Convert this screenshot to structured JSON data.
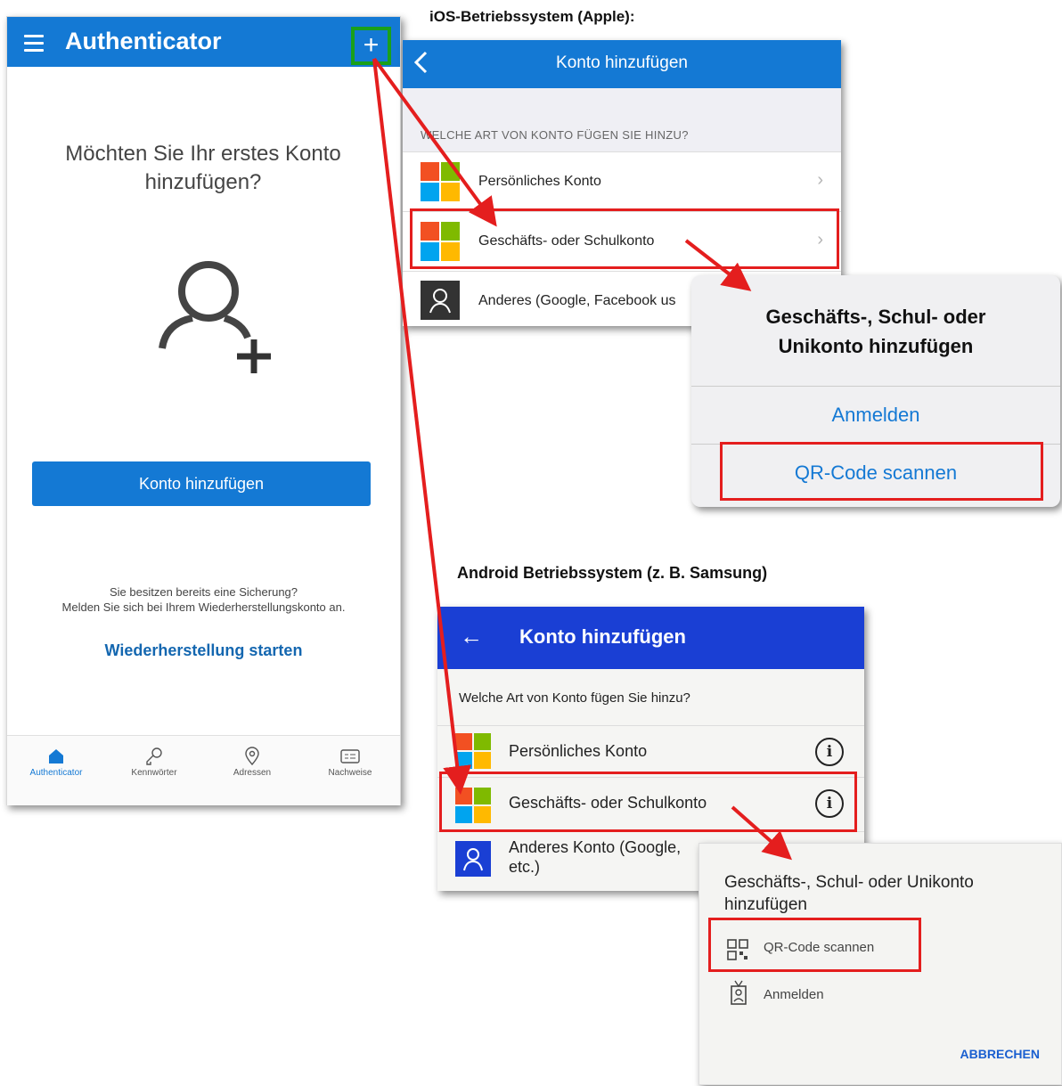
{
  "phone": {
    "title": "Authenticator",
    "question": "Möchten Sie Ihr erstes Konto hinzufügen?",
    "add_button": "Konto hinzufügen",
    "backup_line1": "Sie besitzen bereits eine Sicherung?",
    "backup_line2": "Melden Sie sich bei Ihrem Wiederherstellungskonto an.",
    "restore_link": "Wiederherstellung starten",
    "tabs": [
      {
        "label": "Authenticator",
        "icon": "home-icon"
      },
      {
        "label": "Kennwörter",
        "icon": "key-icon"
      },
      {
        "label": "Adressen",
        "icon": "location-pin-icon"
      },
      {
        "label": "Nachweise",
        "icon": "id-card-icon"
      }
    ]
  },
  "ios": {
    "heading": "iOS-Betriebssystem (Apple):",
    "nav_title": "Konto hinzufügen",
    "section_label": "WELCHE ART VON KONTO FÜGEN SIE HINZU?",
    "rows": [
      {
        "label": "Persönliches Konto"
      },
      {
        "label": "Geschäfts- oder Schulkonto"
      },
      {
        "label": "Anderes (Google, Facebook us"
      }
    ],
    "sheet": {
      "title_line1": "Geschäfts-, Schul- oder",
      "title_line2": "Unikonto hinzufügen",
      "action_signin": "Anmelden",
      "action_qr": "QR-Code scannen"
    }
  },
  "android": {
    "heading": "Android Betriebssystem (z. B. Samsung)",
    "nav_title": "Konto hinzufügen",
    "section_label": "Welche Art von Konto fügen Sie hinzu?",
    "rows": [
      {
        "label": "Persönliches Konto"
      },
      {
        "label": "Geschäfts- oder Schulkonto"
      },
      {
        "label_line1": "Anderes Konto (Google,",
        "label_line2": "etc.)"
      }
    ],
    "dialog": {
      "title_line1": "Geschäfts-, Schul- oder Unikonto",
      "title_line2": "hinzufügen",
      "option_qr": "QR-Code scannen",
      "option_signin": "Anmelden",
      "cancel": "ABBRECHEN"
    }
  },
  "colors": {
    "ms_red": "#f25022",
    "ms_green": "#7fba00",
    "ms_blue": "#00a4ef",
    "ms_yellow": "#ffb900",
    "accent_blue": "#1479d4",
    "android_blue": "#1a3fd4",
    "highlight_red": "#e41e1e",
    "highlight_green": "#1aa01a"
  }
}
